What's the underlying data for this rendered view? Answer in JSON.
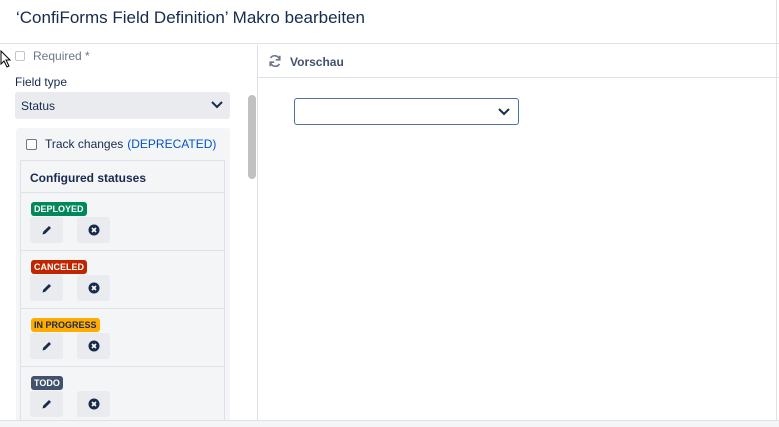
{
  "dialog": {
    "title": "‘ConfiForms Field Definition’ Makro bearbeiten"
  },
  "form": {
    "required_label": "Required *",
    "field_type_label": "Field type",
    "field_type_value": "Status",
    "track_changes_label": "Track changes",
    "track_changes_note": "(DEPRECATED)",
    "configured_statuses_label": "Configured statuses",
    "statuses": [
      {
        "label": "DEPLOYED",
        "color": "#00875a",
        "text_color": "#ffffff"
      },
      {
        "label": "CANCELED",
        "color": "#bf2600",
        "text_color": "#ffffff"
      },
      {
        "label": "IN PROGRESS",
        "color": "#ffab00",
        "text_color": "#172b4d"
      },
      {
        "label": "TODO",
        "color": "#42526e",
        "text_color": "#ffffff"
      }
    ],
    "row_actions": {
      "edit_icon": "pencil-icon",
      "delete_icon": "remove-icon"
    }
  },
  "preview": {
    "label": "Vorschau",
    "icon": "refresh-icon",
    "select_value": ""
  },
  "colors": {
    "accent": "#0052cc",
    "panel_bg": "#f4f5f7",
    "border": "#dfe1e6"
  }
}
